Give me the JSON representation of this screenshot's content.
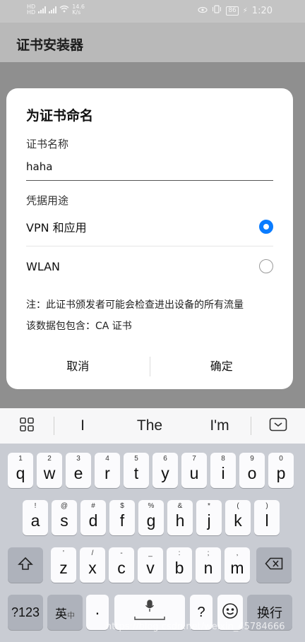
{
  "status": {
    "left_sim1": "HD",
    "left_sim2": "HD",
    "net_speed_value": "14.6",
    "net_speed_unit": "K/s",
    "battery": "86",
    "time": "1:20"
  },
  "app": {
    "title": "证书安装器"
  },
  "dialog": {
    "title": "为证书命名",
    "name_label": "证书名称",
    "name_value": "haha",
    "usage_label": "凭据用途",
    "options": [
      {
        "label": "VPN 和应用",
        "selected": true
      },
      {
        "label": "WLAN",
        "selected": false
      }
    ],
    "note_line1": "注：此证书颁发者可能会检查进出设备的所有流量",
    "note_line2": "该数据包包含：CA 证书",
    "cancel": "取消",
    "ok": "确定"
  },
  "keyboard": {
    "suggestions": [
      "I",
      "The",
      "I'm"
    ],
    "row1": [
      {
        "k": "q",
        "s": "1"
      },
      {
        "k": "w",
        "s": "2"
      },
      {
        "k": "e",
        "s": "3"
      },
      {
        "k": "r",
        "s": "4"
      },
      {
        "k": "t",
        "s": "5"
      },
      {
        "k": "y",
        "s": "6"
      },
      {
        "k": "u",
        "s": "7"
      },
      {
        "k": "i",
        "s": "8"
      },
      {
        "k": "o",
        "s": "9"
      },
      {
        "k": "p",
        "s": "0"
      }
    ],
    "row2": [
      {
        "k": "a",
        "s": "!"
      },
      {
        "k": "s",
        "s": "@"
      },
      {
        "k": "d",
        "s": "#"
      },
      {
        "k": "f",
        "s": "$"
      },
      {
        "k": "g",
        "s": "%"
      },
      {
        "k": "h",
        "s": "&"
      },
      {
        "k": "j",
        "s": "*"
      },
      {
        "k": "k",
        "s": "("
      },
      {
        "k": "l",
        "s": ")"
      }
    ],
    "row3": [
      {
        "k": "z",
        "s": "'"
      },
      {
        "k": "x",
        "s": "/"
      },
      {
        "k": "c",
        "s": "-"
      },
      {
        "k": "v",
        "s": "_"
      },
      {
        "k": "b",
        "s": ":"
      },
      {
        "k": "n",
        "s": ";"
      },
      {
        "k": "m",
        "s": ","
      }
    ],
    "key_123": "?123",
    "key_lang": "英",
    "key_lang_sub": "中",
    "key_dot": "·",
    "key_question": "?",
    "key_enter": "换行"
  },
  "watermark": "https://blog.csdn.net/weixin_45784666"
}
